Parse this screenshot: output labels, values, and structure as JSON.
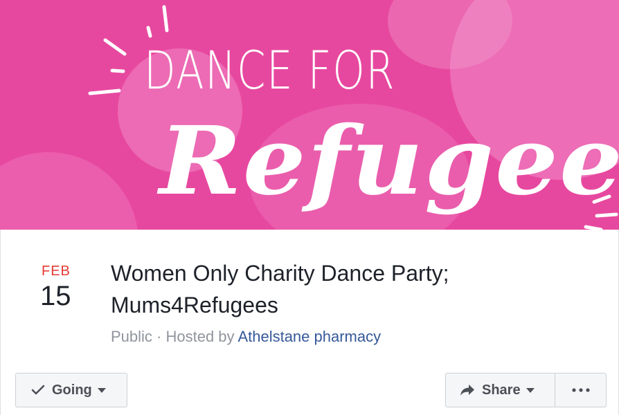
{
  "cover": {
    "line1": "DANCE FOR",
    "line2": "Refugees",
    "background_color": "#e7489f"
  },
  "event": {
    "month": "FEB",
    "day": "15",
    "title_line1": "Women Only Charity Dance Party;",
    "title_line2": "Mums4Refugees",
    "privacy": "Public",
    "separator": " · ",
    "hosted_by_prefix": "Hosted by ",
    "host": "Athelstane pharmacy"
  },
  "actions": {
    "going_label": "Going",
    "share_label": "Share",
    "more_icon": "ellipsis-icon"
  },
  "colors": {
    "month": "#e53935",
    "link": "#365899",
    "meta": "#90949c",
    "text": "#1d2129"
  }
}
